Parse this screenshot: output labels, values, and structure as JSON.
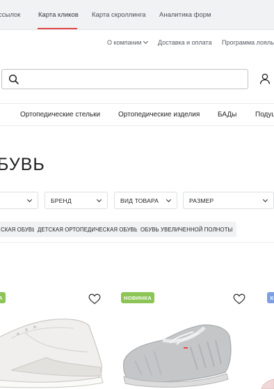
{
  "topbar": {
    "tabs": [
      "ссылок",
      "Карта кликов",
      "Карта скроллинга",
      "Аналитика форм"
    ],
    "active_tab": "Карта кликов",
    "accent_color": "#e0484b"
  },
  "header": {
    "links": [
      "О компании",
      "Доставка и оплата",
      "Программа лояль"
    ],
    "search": {
      "value": "",
      "placeholder": ""
    }
  },
  "catalog_nav": [
    "Ортопедические стельки",
    "Ортопедические изделия",
    "БАДы",
    "Подуш"
  ],
  "page_title": "БУВЬ",
  "filters": [
    "",
    "БРЕНД",
    "ВИД ТОВАРА",
    "РАЗМЕР"
  ],
  "quick_tags": [
    "СКАЯ ОБУВЬ",
    "ДЕТСКАЯ ОРТОПЕДИЧЕСКАЯ ОБУВЬ",
    "ОБУВЬ УВЕЛИЧЕННОЙ ПОЛНОТЫ"
  ],
  "products": [
    {
      "badge": "А",
      "badge_color": "#8cc456",
      "icon": "white-sneaker-image"
    },
    {
      "badge": "НОВИНКА",
      "badge_color": "#8cc456",
      "icon": "grey-knit-sneaker-image"
    },
    {
      "badge": "ХИ",
      "badge_color": "#7b9fe0",
      "icon": "partial-shoe-image"
    }
  ]
}
